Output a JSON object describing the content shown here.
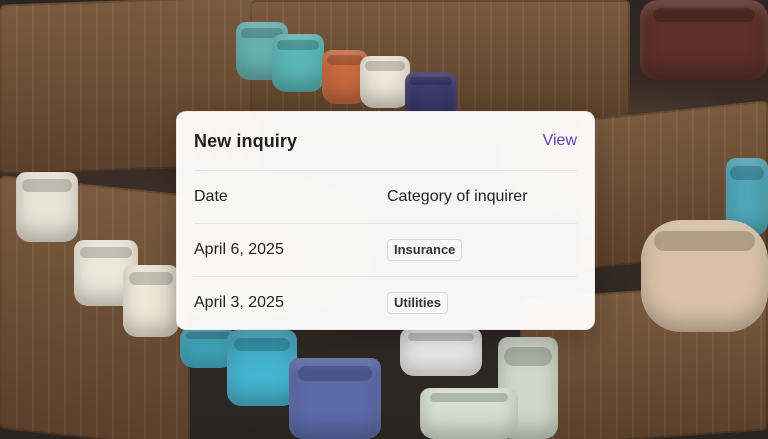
{
  "card": {
    "title": "New inquiry",
    "view_label": "View",
    "columns": [
      "Date",
      "Category of inquirer"
    ],
    "rows": [
      {
        "date": "April 6, 2025",
        "category": "Insurance"
      },
      {
        "date": "April 3, 2025",
        "category": "Utilities"
      }
    ]
  },
  "theme": {
    "accent": "#5a46b5"
  }
}
